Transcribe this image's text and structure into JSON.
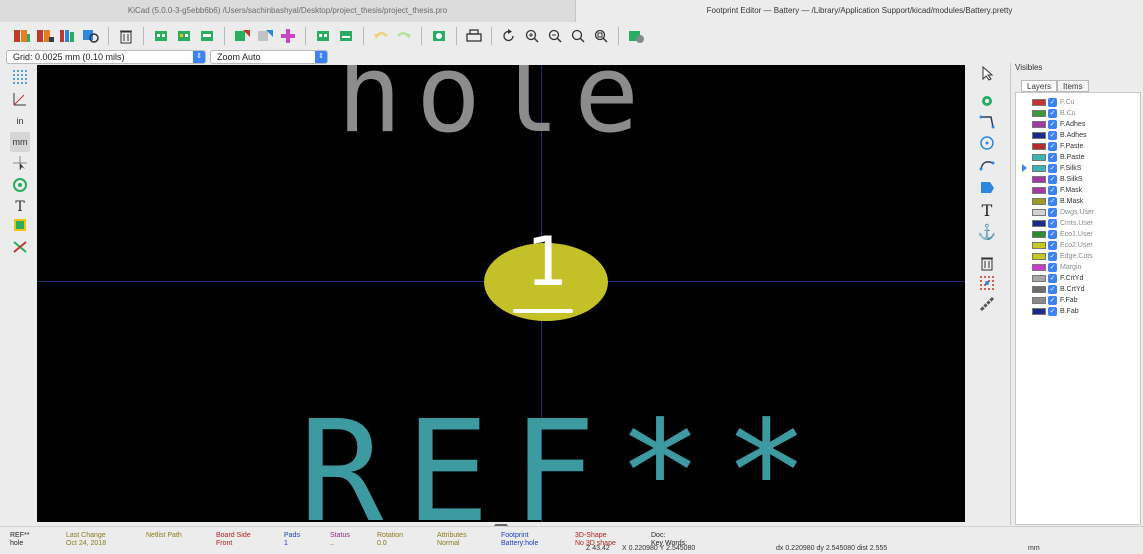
{
  "window": {
    "left_tab_title": "KiCad (5.0.0-3-g5ebb6b6) /Users/sachinbashyal/Desktop/project_thesis/project_thesis.pro",
    "right_tab_title": "Footprint Editor — Battery — /Library/Application Support/kicad/modules/Battery.pretty"
  },
  "selects": {
    "grid": "Grid: 0.0025 mm (0.10 mils)",
    "zoom": "Zoom Auto"
  },
  "canvas": {
    "value_text": "hole",
    "ref_text": "REF**",
    "pad_number": "1"
  },
  "layers_panel": {
    "title": "Visibles",
    "tabs": [
      "Layers",
      "Items"
    ],
    "layers": [
      {
        "name": "F.Cu",
        "color": "#c83232",
        "dim": true
      },
      {
        "name": "B.Cu",
        "color": "#3c9a3c",
        "dim": true
      },
      {
        "name": "F.Adhes",
        "color": "#a23aa2",
        "dim": false
      },
      {
        "name": "B.Adhes",
        "color": "#1c2a8c",
        "dim": false
      },
      {
        "name": "F.Paste",
        "color": "#b42a2a",
        "dim": false
      },
      {
        "name": "B.Paste",
        "color": "#3cb4b4",
        "dim": false
      },
      {
        "name": "F.SilkS",
        "color": "#3cb4b4",
        "dim": false,
        "active": true
      },
      {
        "name": "B.SilkS",
        "color": "#a23aa2",
        "dim": false
      },
      {
        "name": "F.Mask",
        "color": "#a23aa2",
        "dim": false
      },
      {
        "name": "B.Mask",
        "color": "#9c9c24",
        "dim": false
      },
      {
        "name": "Dwgs.User",
        "color": "#d2d2d2",
        "dim": true
      },
      {
        "name": "Cmts.User",
        "color": "#1c2a8c",
        "dim": true
      },
      {
        "name": "Eco1.User",
        "color": "#2c8c2c",
        "dim": true
      },
      {
        "name": "Eco2.User",
        "color": "#c8c81c",
        "dim": true
      },
      {
        "name": "Edge.Cuts",
        "color": "#c8c81c",
        "dim": true
      },
      {
        "name": "Margin",
        "color": "#c83cc8",
        "dim": true
      },
      {
        "name": "F.CrtYd",
        "color": "#a8a8a8",
        "dim": false
      },
      {
        "name": "B.CrtYd",
        "color": "#6e6e6e",
        "dim": false
      },
      {
        "name": "F.Fab",
        "color": "#8a8a8a",
        "dim": false
      },
      {
        "name": "B.Fab",
        "color": "#1c2a8c",
        "dim": false
      }
    ]
  },
  "status": {
    "fields": [
      {
        "label": "REF**",
        "value": "hole",
        "color": "#222222"
      },
      {
        "label": "Last Change",
        "value": "Oct 24, 2018",
        "color": "#8a7a1a"
      },
      {
        "label": "Netlist Path",
        "value": "",
        "color": "#8a7a1a"
      },
      {
        "label": "Board Side",
        "value": "Front",
        "color": "#b22222"
      },
      {
        "label": "Pads",
        "value": "1",
        "color": "#1e3cc8"
      },
      {
        "label": "Status",
        "value": "..",
        "color": "#8a2a8a"
      },
      {
        "label": "Rotation",
        "value": "0.0",
        "color": "#8a7a1a"
      },
      {
        "label": "Attributes",
        "value": "Normal",
        "color": "#8a7a1a"
      },
      {
        "label": "Footprint",
        "value": "Battery:hole",
        "color": "#1e3cc8"
      },
      {
        "label": "3D-Shape",
        "value": "No 3D shape",
        "color": "#b22222"
      },
      {
        "label": "Doc:",
        "value": "Key Words:",
        "color": "#222222"
      }
    ],
    "zoom": "Z 43.42",
    "xy": "X 0.220980  Y 2.545080",
    "delta": "dx 0.220980  dy 2.545080  dist 2.555",
    "units": "mm"
  },
  "icons": {
    "toolbar": [
      "footprint-library-icon",
      "library-browser-icon",
      "library-table-icon",
      "footprint-viewer-icon",
      "delete-icon",
      "new-footprint-icon",
      "footprint-wizard-icon",
      "save-footprint-icon",
      "load-from-board-icon",
      "insert-into-board-icon",
      "add-pad-icon",
      "import-footprint-icon",
      "export-footprint-icon",
      "undo-icon",
      "redo-icon",
      "footprint-properties-icon",
      "print-icon",
      "redraw-icon",
      "zoom-in-icon",
      "zoom-out-icon",
      "zoom-fit-icon",
      "zoom-selection-icon",
      "check-footprint-icon"
    ],
    "left": [
      "grid-icon",
      "polar-coords-icon",
      "inches-icon",
      "millimeters-icon",
      "cursor-shape-icon",
      "pad-sketch-icon",
      "text-sketch-icon",
      "edge-sketch-icon",
      "high-contrast-icon"
    ],
    "right": [
      "select-arrow-icon",
      "add-pad-icon",
      "add-line-icon",
      "add-circle-icon",
      "add-arc-icon",
      "add-polygon-icon",
      "add-text-icon",
      "anchor-icon",
      "delete-tool-icon",
      "grid-origin-icon",
      "measure-icon"
    ]
  }
}
